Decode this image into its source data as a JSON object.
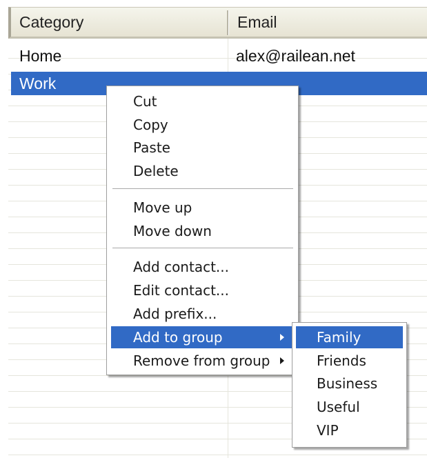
{
  "table": {
    "columns": [
      "Category",
      "Email"
    ],
    "rows": [
      {
        "category": "Home",
        "email": "alex@railean.net",
        "selected": false
      },
      {
        "category": "Work",
        "email": "",
        "selected": true
      }
    ]
  },
  "context_menu": {
    "items": [
      {
        "label": "Cut"
      },
      {
        "label": "Copy"
      },
      {
        "label": "Paste"
      },
      {
        "label": "Delete"
      },
      {
        "label": "Move up"
      },
      {
        "label": "Move down"
      },
      {
        "label": "Add contact..."
      },
      {
        "label": "Edit contact..."
      },
      {
        "label": "Add prefix..."
      },
      {
        "label": "Add to group",
        "highlighted": true,
        "has_submenu": true
      },
      {
        "label": "Remove from group",
        "has_submenu": true
      }
    ]
  },
  "group_submenu": {
    "items": [
      {
        "label": "Family",
        "highlighted": true
      },
      {
        "label": "Friends"
      },
      {
        "label": "Business"
      },
      {
        "label": "Useful"
      },
      {
        "label": "VIP"
      }
    ]
  },
  "colors": {
    "selection": "#316ac5",
    "header_bg": "#ece9d8",
    "gridline": "#e5e5dc"
  }
}
